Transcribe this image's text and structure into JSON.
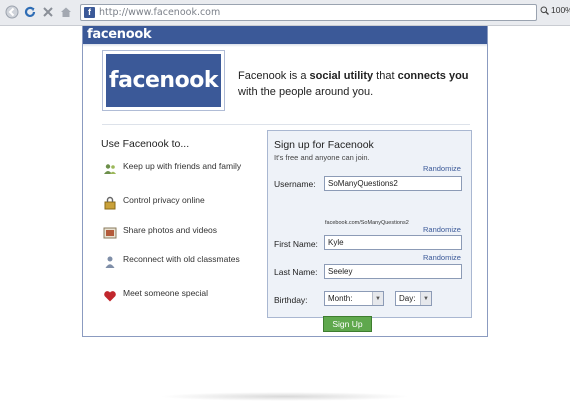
{
  "browser": {
    "url": "http://www.facenook.com",
    "zoom": "100%"
  },
  "header": {
    "logo": "facenook"
  },
  "hero": {
    "logo": "facenook",
    "tagline_parts": [
      "Facenook is a ",
      "social utility",
      " that ",
      "connects",
      " ",
      "you",
      " with the people around you."
    ]
  },
  "features": {
    "title": "Use Facenook to...",
    "items": [
      {
        "label": "Keep up with friends and family",
        "icon": "friends-icon"
      },
      {
        "label": "Control privacy online",
        "icon": "lock-icon"
      },
      {
        "label": "Share photos and videos",
        "icon": "photo-icon"
      },
      {
        "label": "Reconnect with old classmates",
        "icon": "person-icon"
      },
      {
        "label": "Meet someone special",
        "icon": "heart-icon"
      }
    ]
  },
  "signup": {
    "title": "Sign up for Facenook",
    "subtitle": "It's free and anyone can join.",
    "randomize": "Randomize",
    "username_label": "Username:",
    "username_value": "SoManyQuestions2",
    "url_preview": "facebook.com/SoManyQuestions2",
    "first_name_label": "First Name:",
    "first_name_value": "Kyle",
    "last_name_label": "Last Name:",
    "last_name_value": "Seeley",
    "birthday_label": "Birthday:",
    "month_value": "Month:",
    "day_value": "Day:",
    "button": "Sign Up"
  },
  "colors": {
    "brand": "#3b5998",
    "button": "#5fa84d"
  }
}
